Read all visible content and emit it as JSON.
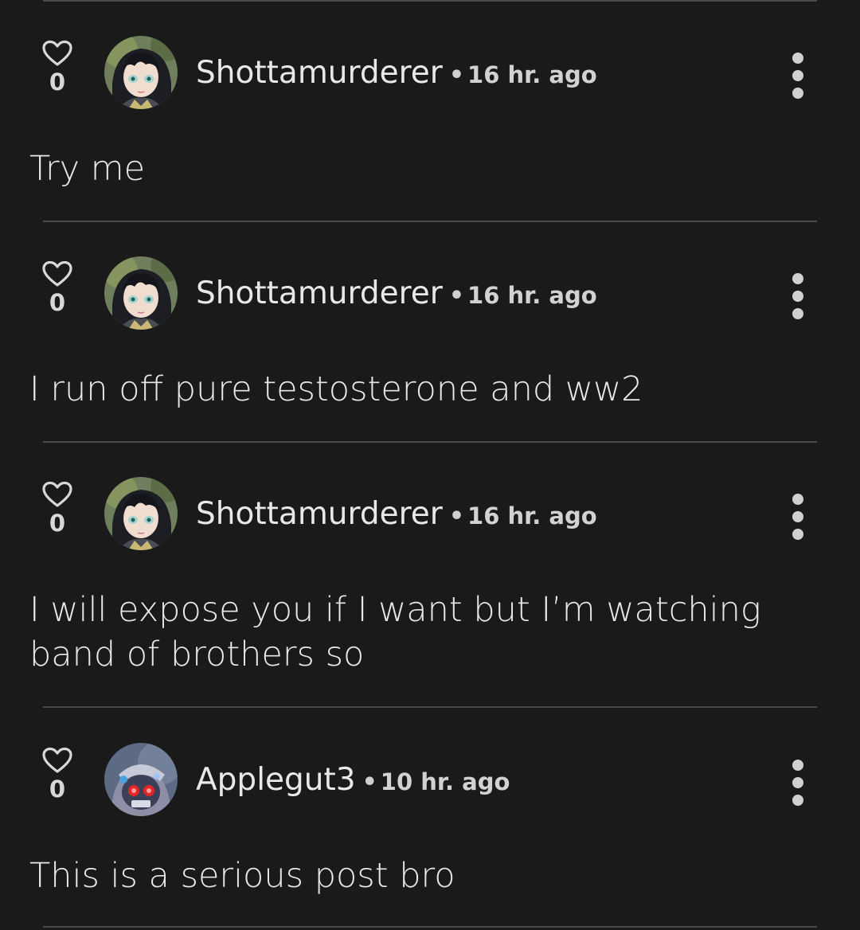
{
  "comments": [
    {
      "likes": "0",
      "username": "Shottamurderer",
      "separator": "•",
      "time": "16 hr. ago",
      "text": "Try me",
      "avatar": "anime-character-avatar"
    },
    {
      "likes": "0",
      "username": "Shottamurderer",
      "separator": "•",
      "time": "16 hr. ago",
      "text": "I run off pure testosterone and ww2",
      "avatar": "anime-character-avatar"
    },
    {
      "likes": "0",
      "username": "Shottamurderer",
      "separator": "•",
      "time": "16 hr. ago",
      "text": "I will expose you if I want but I’m watching band of brothers so",
      "avatar": "anime-character-avatar"
    },
    {
      "likes": "0",
      "username": "Applegut3",
      "separator": "•",
      "time": "10 hr. ago",
      "text": "This is a serious post bro",
      "avatar": "hooded-red-eyes-avatar"
    }
  ],
  "icons": {
    "like": "heart-outline-icon",
    "more": "vertical-ellipsis-icon"
  },
  "colors": {
    "background": "#1a1a1b",
    "divider": "#4a4a4b",
    "text": "#e8e8e8"
  }
}
